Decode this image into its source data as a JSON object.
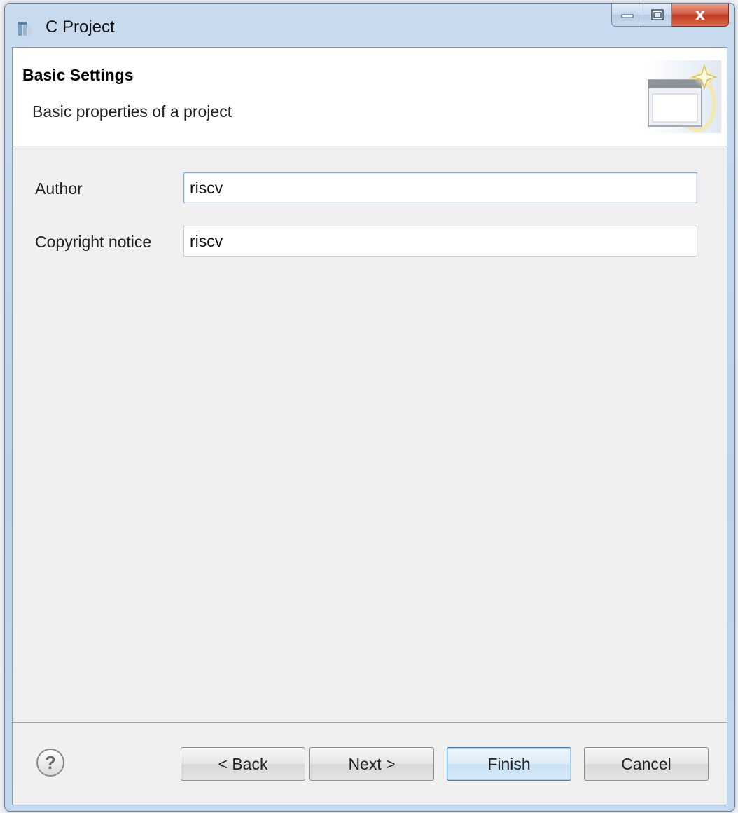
{
  "window": {
    "title": "C Project",
    "icon": "cdt-project-icon",
    "minimize_icon": "minimize-icon",
    "maximize_icon": "maximize-icon",
    "close_icon": "close-icon",
    "close_glyph": "x"
  },
  "banner": {
    "title": "Basic Settings",
    "description": "Basic properties of a project",
    "image": "wizard-banner-icon"
  },
  "form": {
    "author_label": "Author",
    "author_value": "riscv",
    "copyright_label": "Copyright notice",
    "copyright_value": "riscv"
  },
  "footer": {
    "help_glyph": "?",
    "back_label": "< Back",
    "next_label": "Next >",
    "finish_label": "Finish",
    "cancel_label": "Cancel"
  },
  "colors": {
    "client_background": "#f0f0f0",
    "banner_background": "#ffffff",
    "close_button": "#c7422a",
    "default_button_border": "#3c7fb1"
  }
}
